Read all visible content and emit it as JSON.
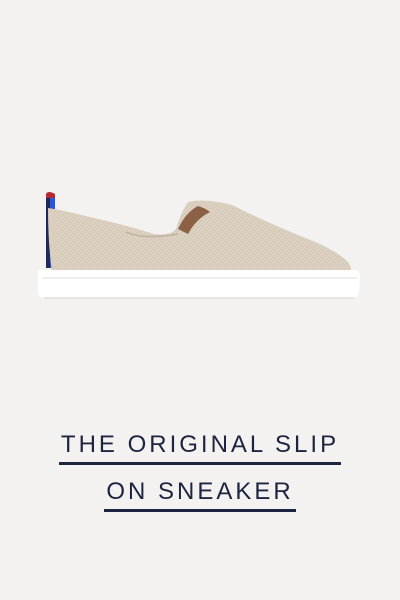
{
  "product": {
    "title_line_1": "THE ORIGINAL SLIP",
    "title_line_2": "ON SNEAKER",
    "image_icon": "slip-on-sneaker-image",
    "colors": {
      "background": "#f3f2f0",
      "title": "#1c2440",
      "upper": "#ddd2c2",
      "sole": "#ffffff",
      "heel_accent": "#2a58d8"
    }
  }
}
